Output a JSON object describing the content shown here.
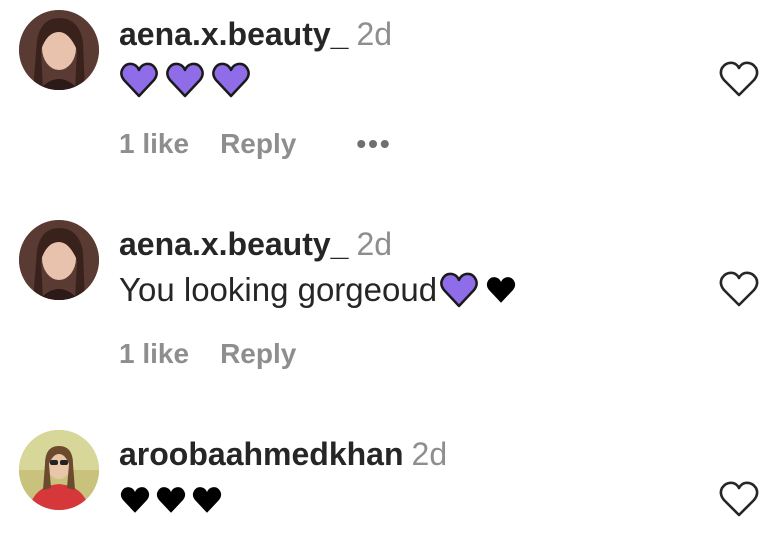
{
  "comments": [
    {
      "username": "aena.x.beauty_",
      "time": "2d",
      "text": "",
      "emojis": [
        "purple-heart",
        "purple-heart",
        "purple-heart"
      ],
      "likes": "1 like",
      "reply": "Reply",
      "more": "•••"
    },
    {
      "username": "aena.x.beauty_",
      "time": "2d",
      "text": "You looking gorgeoud",
      "emojis": [
        "purple-heart",
        "black-heart"
      ],
      "likes": "1 like",
      "reply": "Reply"
    },
    {
      "username": "aroobaahmedkhan",
      "time": "2d",
      "text": "",
      "emojis": [
        "black-heart",
        "black-heart",
        "black-heart"
      ]
    }
  ],
  "colors": {
    "purple_heart": "#8f6ce8",
    "black_heart": "#000000",
    "username": "#262626",
    "secondary": "#8e8e8e"
  }
}
